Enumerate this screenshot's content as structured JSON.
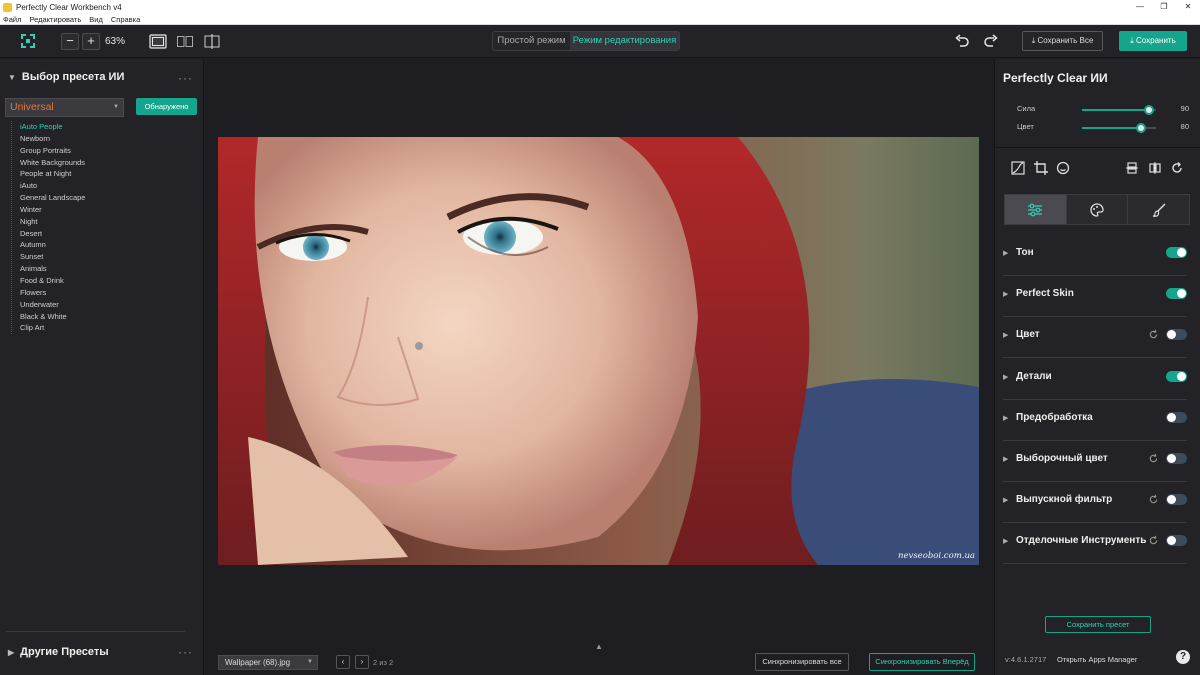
{
  "window": {
    "title": "Perfectly Clear Workbench v4",
    "controls": [
      "—",
      "❐",
      "✕"
    ]
  },
  "menu": [
    "Файл",
    "Редактировать",
    "Вид",
    "Справка"
  ],
  "toolbar": {
    "zoom_out": "−",
    "zoom_in": "+",
    "zoom_level": "63%",
    "mode_simple": "Простой режим",
    "mode_edit": "Режим редактирования",
    "save_all": "Сохранить Все",
    "save": "Сохранить"
  },
  "left_panel": {
    "header": "Выбор пресета ИИ",
    "dots": "···",
    "selected_preset": "Universal",
    "detected_button": "Обнаружено",
    "presets": [
      "iAuto People",
      "Newborn",
      "Group Portraits",
      "White Backgrounds",
      "People at Night",
      "iAuto",
      "General Landscape",
      "Winter",
      "Night",
      "Desert",
      "Autumn",
      "Sunset",
      "Animals",
      "Food & Drink",
      "Flowers",
      "Underwater",
      "Black & White",
      "Clip Art"
    ],
    "active_preset_index": 0,
    "other_header": "Другие Пресеты"
  },
  "center": {
    "watermark": "nevseoboi.com.ua",
    "file_name": "Wallpaper (68).jpg",
    "prev": "‹",
    "next": "›",
    "page_info": "2 из 2",
    "sync_all": "Синхронизировать все",
    "sync_forward": "Синхронизировать Вперёд"
  },
  "right_panel": {
    "title": "Perfectly Clear ИИ",
    "sliders": [
      {
        "label": "Сила",
        "value": 90
      },
      {
        "label": "Цвет",
        "value": 80
      }
    ],
    "sections": [
      {
        "name": "Тон",
        "on": true,
        "reset": false
      },
      {
        "name": "Perfect Skin",
        "on": true,
        "reset": false
      },
      {
        "name": "Цвет",
        "on": false,
        "reset": true
      },
      {
        "name": "Детали",
        "on": true,
        "reset": false
      },
      {
        "name": "Предобработка",
        "on": false,
        "reset": false
      },
      {
        "name": "Выборочный цвет",
        "on": false,
        "reset": true
      },
      {
        "name": "Выпускной фильтр",
        "on": false,
        "reset": true
      },
      {
        "name": "Отделочные Инструменты",
        "on": false,
        "reset": true
      }
    ],
    "save_preset": "Сохранить пресет",
    "version": "v:4.6.1.2717",
    "apps_manager": "Открыть Apps Manager",
    "help": "?"
  },
  "colors": {
    "accent": "#14a58c",
    "accent_text": "#2fd0b5",
    "preset_orange": "#e2783b"
  }
}
